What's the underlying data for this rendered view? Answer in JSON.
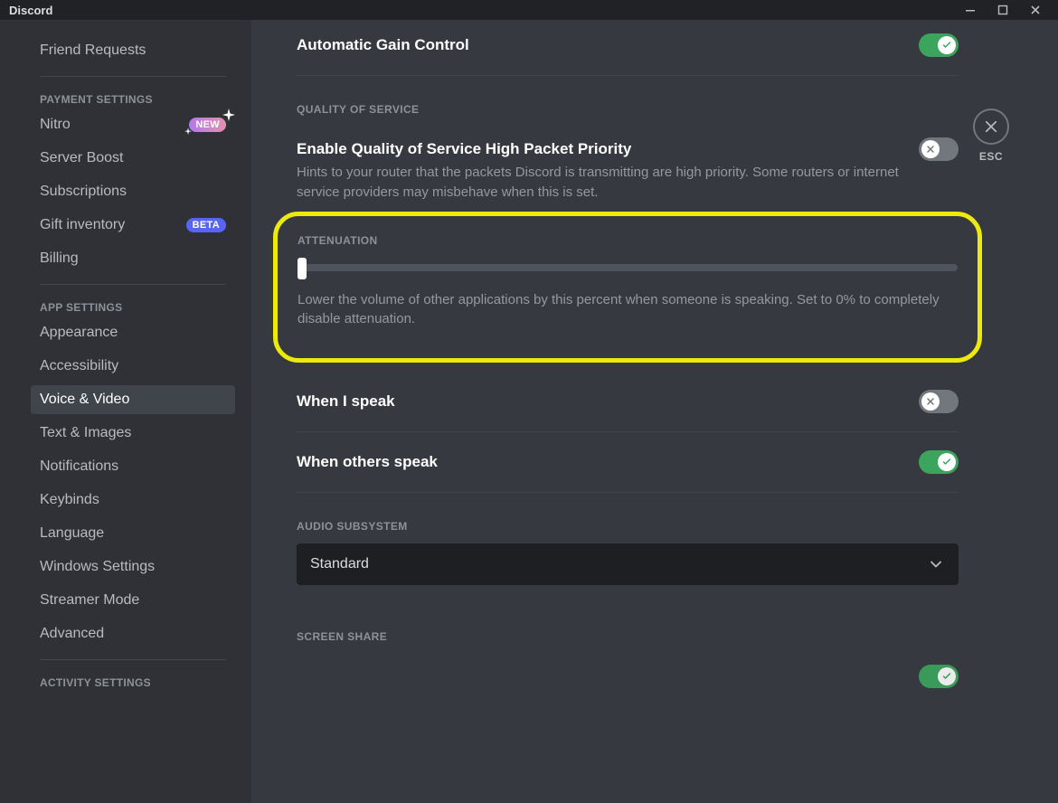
{
  "app": {
    "title": "Discord"
  },
  "sidebar": {
    "top_item": "Friend Requests",
    "groups": [
      {
        "header": "PAYMENT SETTINGS",
        "items": [
          {
            "label": "Nitro",
            "tag": "NEW"
          },
          {
            "label": "Server Boost"
          },
          {
            "label": "Subscriptions"
          },
          {
            "label": "Gift inventory",
            "tag": "BETA"
          },
          {
            "label": "Billing"
          }
        ]
      },
      {
        "header": "APP SETTINGS",
        "items": [
          {
            "label": "Appearance"
          },
          {
            "label": "Accessibility"
          },
          {
            "label": "Voice & Video",
            "selected": true
          },
          {
            "label": "Text & Images"
          },
          {
            "label": "Notifications"
          },
          {
            "label": "Keybinds"
          },
          {
            "label": "Language"
          },
          {
            "label": "Windows Settings"
          },
          {
            "label": "Streamer Mode"
          },
          {
            "label": "Advanced"
          }
        ]
      },
      {
        "header": "ACTIVITY SETTINGS",
        "items": []
      }
    ]
  },
  "close": {
    "label": "ESC"
  },
  "settings": {
    "agc": {
      "label": "Automatic Gain Control",
      "on": true
    },
    "qos": {
      "header": "QUALITY OF SERVICE",
      "label": "Enable Quality of Service High Packet Priority",
      "desc": "Hints to your router that the packets Discord is transmitting are high priority. Some routers or internet service providers may misbehave when this is set.",
      "on": false
    },
    "attenuation": {
      "header": "ATTENUATION",
      "desc": "Lower the volume of other applications by this percent when someone is speaking. Set to 0% to completely disable attenuation.",
      "value_percent": 0,
      "when_i_speak": {
        "label": "When I speak",
        "on": false
      },
      "when_others_speak": {
        "label": "When others speak",
        "on": true
      }
    },
    "audio_subsystem": {
      "header": "AUDIO SUBSYSTEM",
      "selected": "Standard"
    },
    "screen_share": {
      "header": "SCREEN SHARE"
    }
  }
}
